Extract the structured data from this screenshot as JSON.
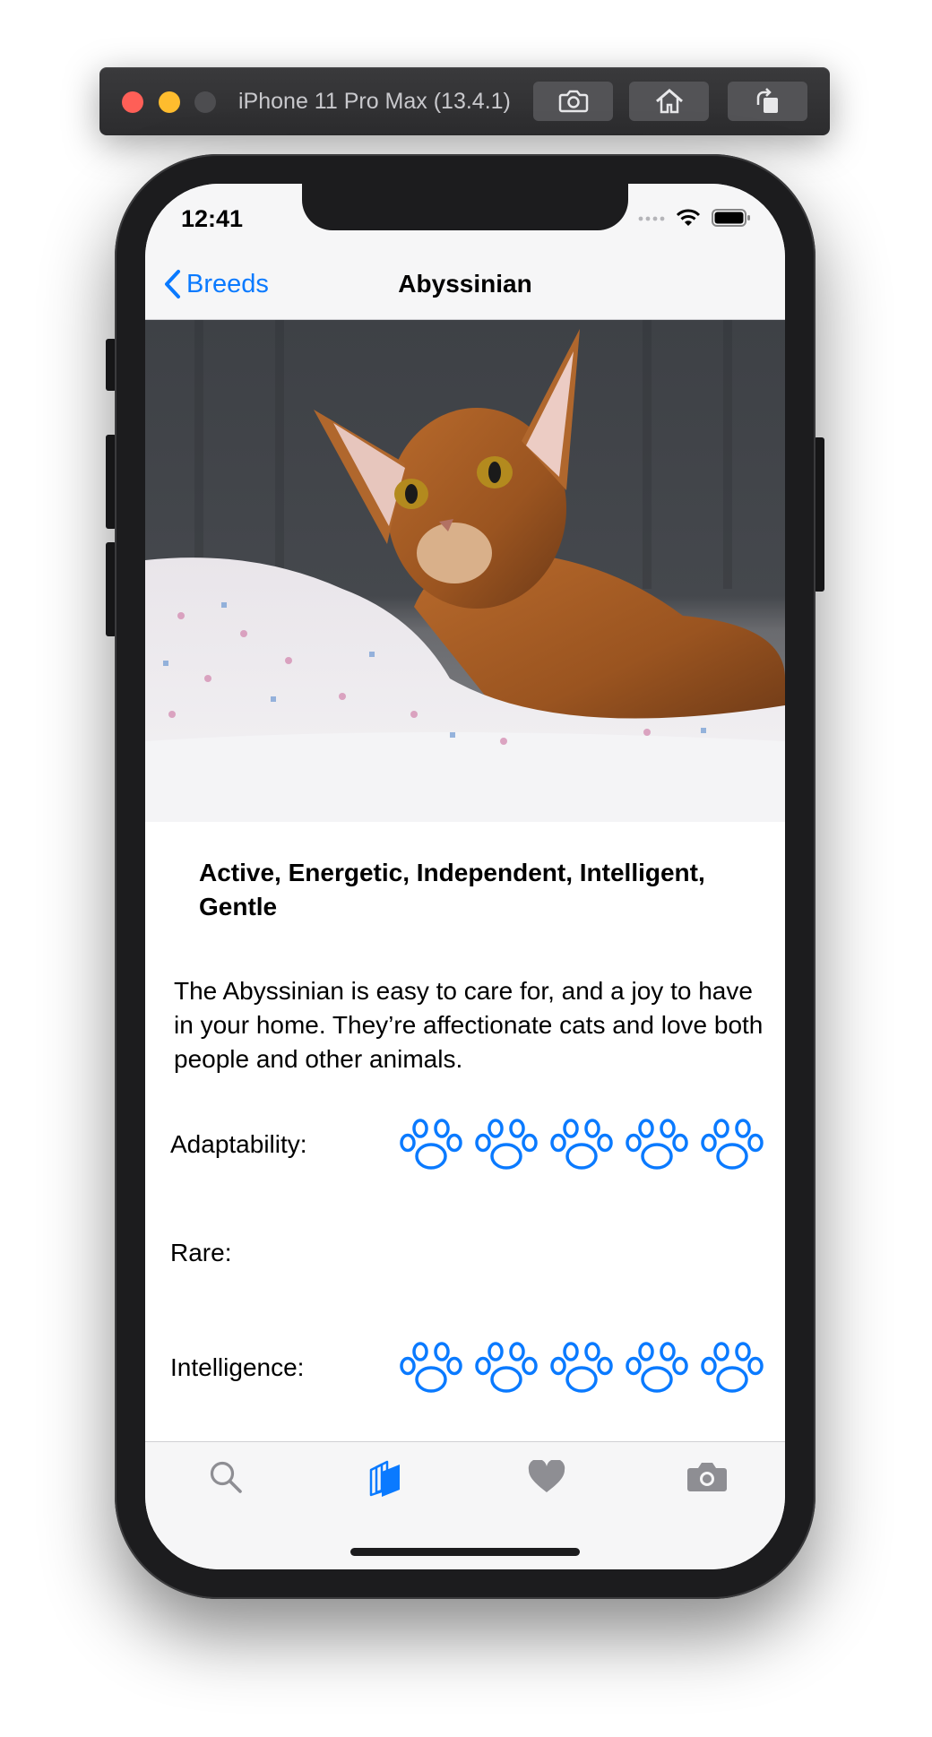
{
  "simulator": {
    "title": "iPhone 11 Pro Max (13.4.1)",
    "buttons": [
      "screenshot",
      "home",
      "rotate"
    ]
  },
  "status_bar": {
    "time": "12:41"
  },
  "nav": {
    "back_label": "Breeds",
    "title": "Abyssinian"
  },
  "hero_image": {
    "subject": "abyssinian cat photo"
  },
  "breed": {
    "temperament": "Active, Energetic, Independent, Intelligent, Gentle",
    "description": "The Abyssinian is easy to care for, and a joy to have in your home. They’re affectionate cats and love both people and other animals."
  },
  "ratings": [
    {
      "label": "Adaptability:",
      "value": 5,
      "max": 5
    },
    {
      "label": "Rare:",
      "value": 0,
      "max": 5
    },
    {
      "label": "Intelligence:",
      "value": 5,
      "max": 5
    }
  ],
  "tabbar": {
    "tabs": [
      {
        "name": "search",
        "icon": "magnifier-icon",
        "selected": false
      },
      {
        "name": "breeds",
        "icon": "books-icon",
        "selected": true
      },
      {
        "name": "favorites",
        "icon": "heart-icon",
        "selected": false
      },
      {
        "name": "camera",
        "icon": "camera-icon",
        "selected": false
      }
    ]
  },
  "colors": {
    "accent": "#0a7aff",
    "tab_inactive": "#8e8e93"
  }
}
